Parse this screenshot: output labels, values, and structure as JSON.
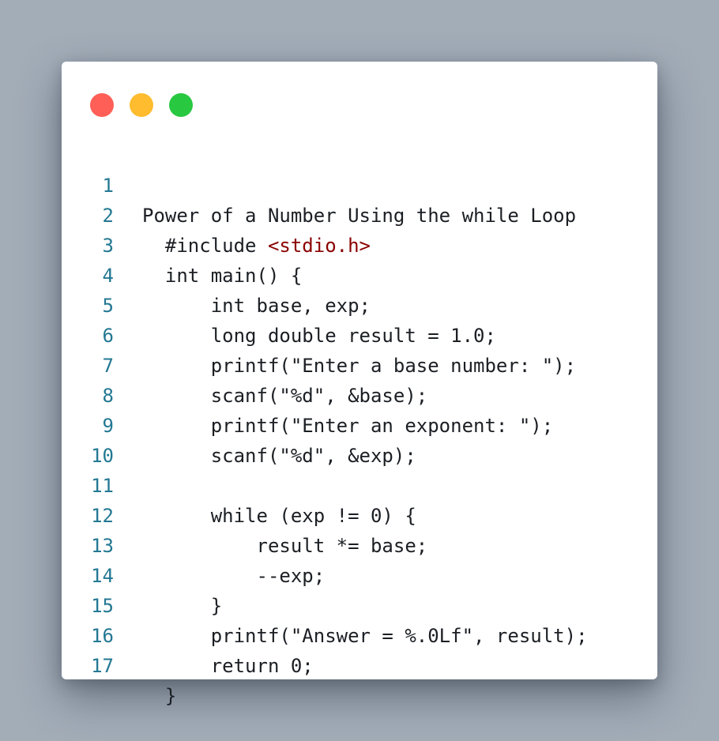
{
  "window": {
    "controls": [
      "close",
      "minimize",
      "maximize"
    ],
    "colors": {
      "close": "#ff5f57",
      "minimize": "#febc2e",
      "maximize": "#28c840",
      "line_numbers": "#237893",
      "include_path": "#8b0000"
    }
  },
  "code": {
    "lines": [
      {
        "number": "1",
        "text": "Power of a Number Using the while Loop"
      },
      {
        "number": "2",
        "text": "  #include ",
        "extra": "<stdio.h>"
      },
      {
        "number": "3",
        "text": "  int main() {"
      },
      {
        "number": "4",
        "text": "      int base, exp;"
      },
      {
        "number": "5",
        "text": "      long double result = 1.0;"
      },
      {
        "number": "6",
        "text": "      printf(\"Enter a base number: \");"
      },
      {
        "number": "7",
        "text": "      scanf(\"%d\", &base);"
      },
      {
        "number": "8",
        "text": "      printf(\"Enter an exponent: \");"
      },
      {
        "number": "9",
        "text": "      scanf(\"%d\", &exp);"
      },
      {
        "number": "10",
        "text": ""
      },
      {
        "number": "11",
        "text": "      while (exp != 0) {"
      },
      {
        "number": "12",
        "text": "          result *= base;"
      },
      {
        "number": "13",
        "text": "          --exp;"
      },
      {
        "number": "14",
        "text": "      }"
      },
      {
        "number": "15",
        "text": "      printf(\"Answer = %.0Lf\", result);"
      },
      {
        "number": "16",
        "text": "      return 0;"
      },
      {
        "number": "17",
        "text": "  }"
      }
    ]
  }
}
